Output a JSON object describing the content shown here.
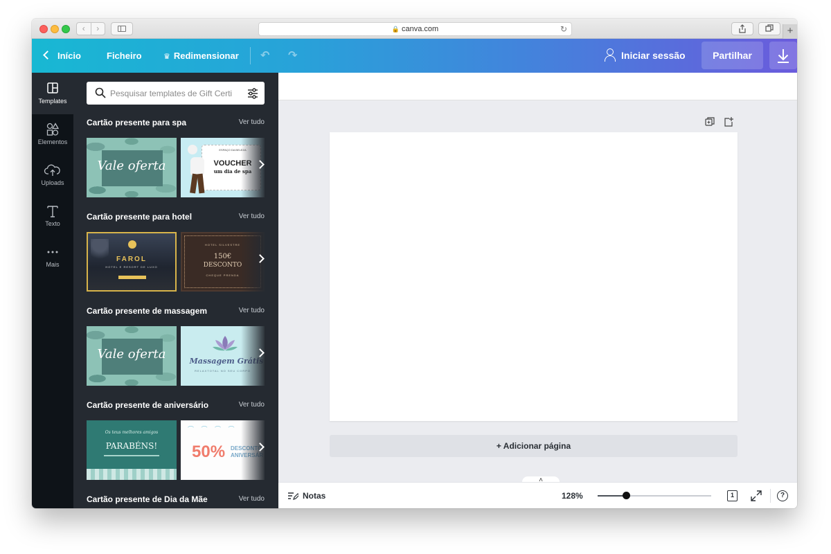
{
  "browser": {
    "url": "canva.com"
  },
  "toolbar": {
    "back_label": "Início",
    "file_label": "Ficheiro",
    "resize_label": "Redimensionar",
    "login_label": "Iniciar sessão",
    "share_label": "Partilhar"
  },
  "rail": {
    "items": [
      {
        "label": "Templates",
        "icon": "templates-icon",
        "active": true
      },
      {
        "label": "Elementos",
        "icon": "shapes-icon"
      },
      {
        "label": "Uploads",
        "icon": "cloud-upload-icon"
      },
      {
        "label": "Texto",
        "icon": "text-icon"
      },
      {
        "label": "Mais",
        "icon": "more-dots-icon"
      }
    ]
  },
  "panel": {
    "search_placeholder": "Pesquisar templates de Gift Certi",
    "sections": [
      {
        "title": "Cartão presente para spa",
        "see_all": "Ver tudo",
        "thumb_a": {
          "text": "Vale oferta"
        },
        "thumb_b": {
          "small": "ESPAÇO DA BELEZA",
          "text": "VOUCHER",
          "sub": "um dia de spa"
        }
      },
      {
        "title": "Cartão presente para hotel",
        "see_all": "Ver tudo",
        "thumb_a": {
          "text": "FAROL",
          "small": "HOTEL E RESORT DE LUXO"
        },
        "thumb_b": {
          "small": "HOTEL SILVESTRE",
          "text": "150€",
          "sub": "DESCONTO",
          "foot": "CHEQUE PRENDA"
        }
      },
      {
        "title": "Cartão presente de massagem",
        "see_all": "Ver tudo",
        "thumb_a": {
          "text": "Vale oferta"
        },
        "thumb_b": {
          "text": "Massagem Grátis",
          "small": "RELAXTOTAL NO SEU CORPO"
        }
      },
      {
        "title": "Cartão presente de aniversário",
        "see_all": "Ver tudo",
        "thumb_a": {
          "small": "Os teus melhores amigos",
          "text": "PARABÉNS!"
        },
        "thumb_b": {
          "text": "50%",
          "sub": "DESCONTO",
          "sub2": "ANIVERSÁR"
        }
      },
      {
        "title": "Cartão presente de Dia da Mãe",
        "see_all": "Ver tudo"
      }
    ]
  },
  "editor": {
    "add_page_label": "+ Adicionar página"
  },
  "footer": {
    "notes_label": "Notas",
    "zoom": "128%",
    "zoom_fraction": 0.25,
    "page_count": "1",
    "help": "?"
  },
  "colors": {
    "toolbar_gradient_start": "#18b8d3",
    "toolbar_gradient_end": "#6a5bdc",
    "panel_bg": "#252a31",
    "rail_bg": "#0e1318",
    "editor_bg": "#ebecf0"
  }
}
